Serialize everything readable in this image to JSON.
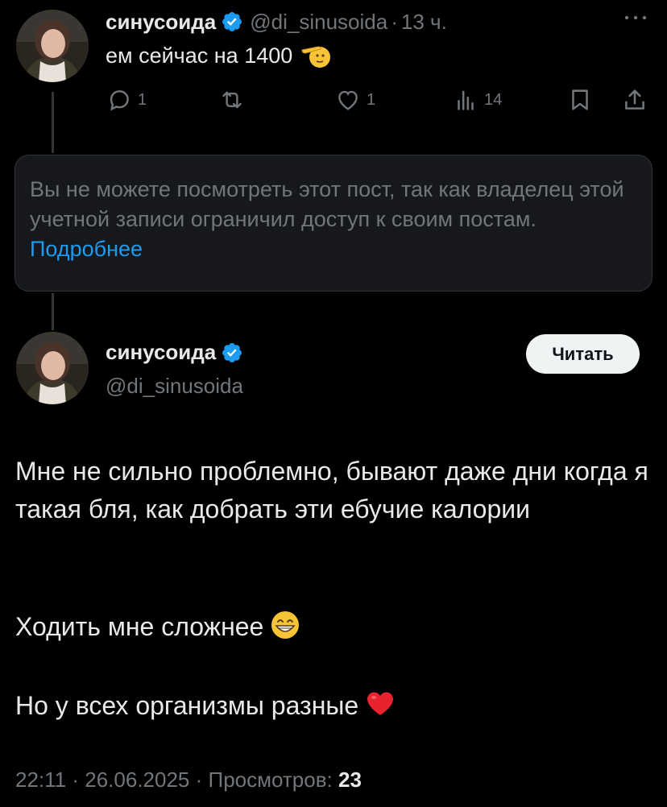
{
  "reply_tweet": {
    "author_name": "синусоида",
    "handle": "@di_sinusoida",
    "separator": "·",
    "time": "13 ч.",
    "text": "ем сейчас на 1400",
    "emoji": "saluting-face",
    "actions": {
      "replies": "1",
      "retweets": "",
      "likes": "1",
      "views": "14"
    }
  },
  "restricted_notice": {
    "text": "Вы не можете посмотреть этот пост, так как владелец этой учетной записи ограничил доступ к своим постам.",
    "link_text": "Подробнее"
  },
  "main_tweet": {
    "author_name": "синусоида",
    "handle": "@di_sinusoida",
    "follow_label": "Читать",
    "paragraph_1": "Мне не сильно проблемно, бывают даже дни когда я такая бля, как добрать эти ебучие калории",
    "paragraph_2": "Ходить мне сложнее",
    "paragraph_2_emoji": "grinning-face-with-smiling-eyes",
    "paragraph_3": "Но у всех организмы разные",
    "paragraph_3_emoji": "red-heart",
    "time": "22:11",
    "date": "26.06.2025",
    "views_label": "Просмотров:",
    "views_count": "23"
  },
  "colors": {
    "background": "#000000",
    "text": "#e7e9ea",
    "muted": "#71767b",
    "link": "#1d9bf0",
    "verified": "#1d9bf0"
  }
}
